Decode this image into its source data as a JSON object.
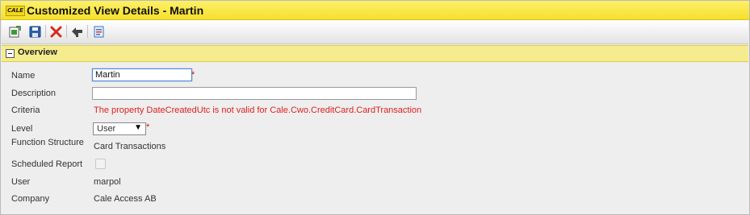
{
  "window": {
    "title": "Customized View Details - Martin",
    "logo_text": "CALE"
  },
  "toolbar": {
    "buttons": [
      {
        "name": "new-icon",
        "tooltip": ""
      },
      {
        "name": "save-icon",
        "tooltip": ""
      },
      {
        "name": "delete-icon",
        "tooltip": ""
      },
      {
        "name": "back-icon",
        "tooltip": ""
      },
      {
        "name": "report-icon",
        "tooltip": ""
      }
    ]
  },
  "section": {
    "title": "Overview"
  },
  "form": {
    "name_label": "Name",
    "name_value": "Martin",
    "description_label": "Description",
    "description_value": "",
    "criteria_label": "Criteria",
    "criteria_value": "The property DateCreatedUtc is not valid for Cale.Cwo.CreditCard.CardTransaction",
    "level_label": "Level",
    "level_value": "User",
    "function_label": "Function Structure",
    "function_value": "Card Transactions",
    "scheduled_label": "Scheduled Report",
    "scheduled_checked": false,
    "user_label": "User",
    "user_value": "marpol",
    "company_label": "Company",
    "company_value": "Cale Access AB",
    "required_mark": "*"
  },
  "colors": {
    "title_bar": "#f6e02c",
    "section_header": "#f4ec8e",
    "error": "#e02020",
    "focus": "#4f8ad9"
  }
}
